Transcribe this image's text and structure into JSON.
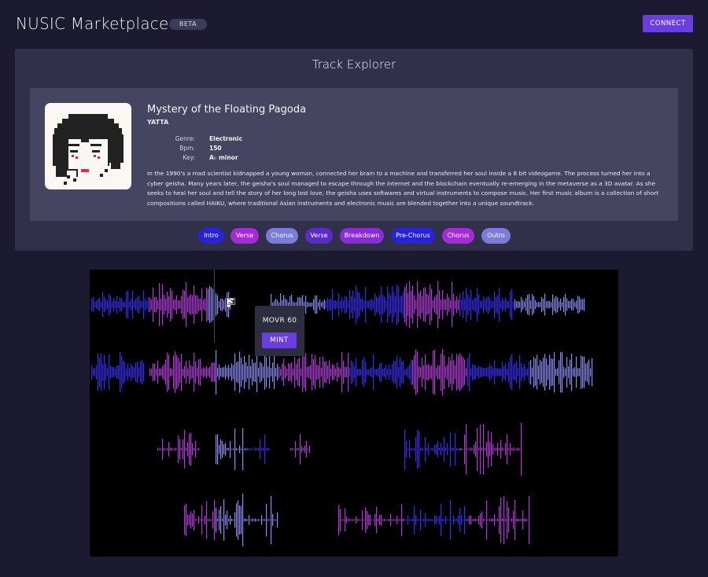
{
  "header": {
    "app_title": "NUSIC Marketplace",
    "badge": "BETA",
    "connect_label": "CONNECT"
  },
  "explorer": {
    "title": "Track Explorer",
    "track": {
      "title": "Mystery of the Floating Pagoda",
      "artist": "YATTA",
      "meta": [
        {
          "label": "Genre:",
          "value": "Electronic"
        },
        {
          "label": "Bpm:",
          "value": "150"
        },
        {
          "label": "Key:",
          "value": "A♭ minor"
        }
      ],
      "description": "In the 1990's a mad scientist kidnapped a young woman, connected her brain to a machine and transferred her soul inside a 8 bit videogame. The process turned her into a cyber geisha. Many years later, the geisha's soul managed to escape through the internet and the blockchain eventually re-emerging in the metaverse as a 3D avatar. As she seeks to heal her soul and tell the story of her long lost love, the geisha uses softwares and virtual instruments to compose music. Her first music album is a collection of short compositions called HAIKU, where traditional Asian instruments and electronic music are blended together into a unique soundtrack."
    },
    "sections": [
      {
        "label": "Intro",
        "color": "#2a22d8"
      },
      {
        "label": "Verse",
        "color": "#a42bd6"
      },
      {
        "label": "Chorus",
        "color": "#7b7bd9"
      },
      {
        "label": "Verse",
        "color": "#5a2bc8"
      },
      {
        "label": "Breakdown",
        "color": "#8a2bd8"
      },
      {
        "label": "Pre-Chorus",
        "color": "#2a22d8"
      },
      {
        "label": "Chorus",
        "color": "#a42bd6"
      },
      {
        "label": "Outro",
        "color": "#7b7bd9"
      }
    ]
  },
  "player": {
    "controls": [
      "play-icon",
      "music-note-icon",
      "image-icon"
    ],
    "price": "MOVR 60",
    "mint_label": "MINT"
  },
  "colors": {
    "accent": "#6a3fe0",
    "background": "#1b1a31",
    "panel": "#30304a",
    "card": "#454561",
    "wave_blue": "#3a2df0",
    "wave_magenta": "#b03ad8",
    "wave_periwinkle": "#8a8af0"
  }
}
